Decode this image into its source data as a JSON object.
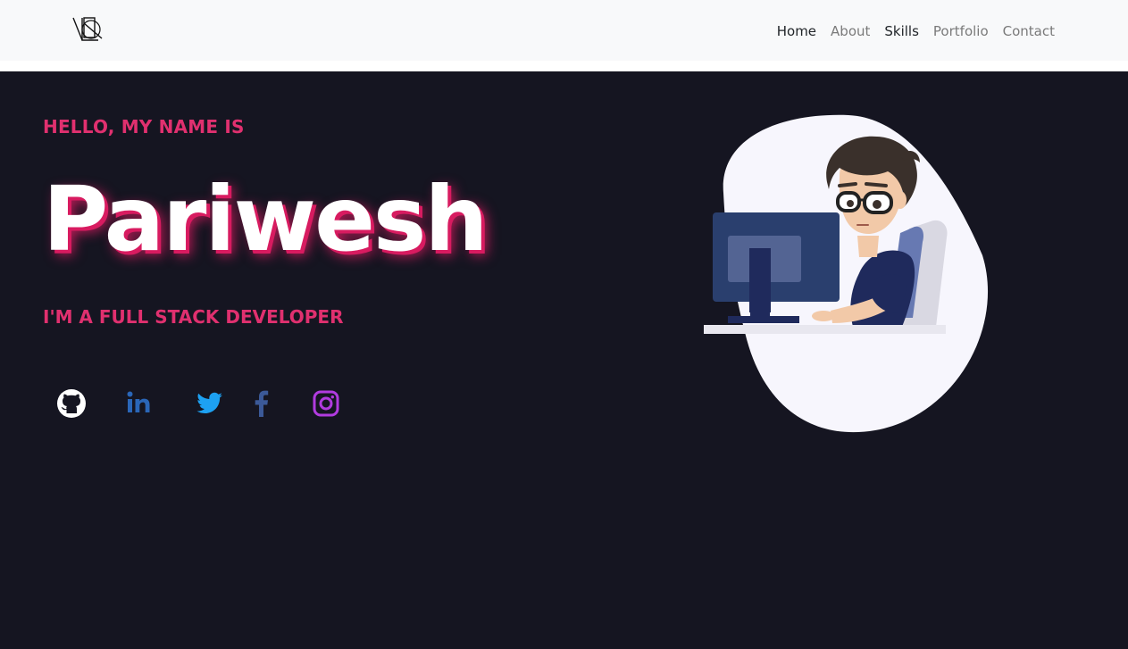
{
  "navbar": {
    "logo_icon": "pv-monogram-logo",
    "links": [
      {
        "label": "Home",
        "tone": "dark"
      },
      {
        "label": "About",
        "tone": "muted"
      },
      {
        "label": "Skills",
        "tone": "dark"
      },
      {
        "label": "Portfolio",
        "tone": "muted"
      },
      {
        "label": "Contact",
        "tone": "muted"
      }
    ]
  },
  "hero": {
    "greeting": "HELLO, MY NAME IS",
    "name": "Pariwesh",
    "role": "I'M A FULL STACK DEVELOPER",
    "illustration": "developer-at-computer-illustration",
    "socials": [
      {
        "icon": "github-icon",
        "color": "#ffffff"
      },
      {
        "icon": "linkedin-icon",
        "color": "#2a66b8"
      },
      {
        "icon": "twitter-icon",
        "color": "#1da1f2"
      },
      {
        "icon": "facebook-icon",
        "color": "#3b5998"
      },
      {
        "icon": "instagram-icon",
        "color": "#b13bdf"
      }
    ]
  },
  "colors": {
    "accent": "#e0306f",
    "hero_background": "#151521",
    "navbar_background": "#f8f9fa"
  }
}
